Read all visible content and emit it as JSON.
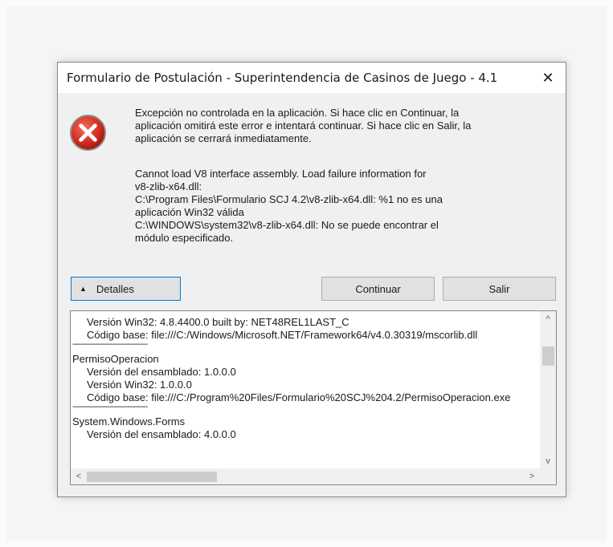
{
  "dialog": {
    "title": "Formulario de Postulación - Superintendencia de Casinos de Juego - 4.1",
    "close_symbol": "✕",
    "message_lines": [
      "Excepción no controlada en la aplicación. Si hace clic en Continuar, la",
      "aplicación omitirá este error e intentará continuar. Si hace clic en Salir, la",
      "aplicación se cerrará inmediatamente."
    ],
    "error_lines": [
      "Cannot load V8 interface assembly. Load failure information for",
      "v8-zlib-x64.dll:",
      "C:\\Program Files\\Formulario SCJ 4.2\\v8-zlib-x64.dll: %1 no es una",
      "aplicación Win32 válida",
      "C:\\WINDOWS\\system32\\v8-zlib-x64.dll: No se puede encontrar el",
      "módulo especificado."
    ],
    "buttons": {
      "details": "Detalles",
      "details_arrow": "▲",
      "continue": "Continuar",
      "exit": "Salir"
    },
    "details_lines": [
      "Versión Win32: 4.8.4400.0 built by: NET48REL1LAST_C",
      "Código base: file:///C:/Windows/Microsoft.NET/Framework64/v4.0.30319/mscorlib.dll",
      "----------------------------------------",
      "PermisoOperacion",
      "Versión del ensamblado: 1.0.0.0",
      "Versión Win32: 1.0.0.0",
      "Código base: file:///C:/Program%20Files/Formulario%20SCJ%204.2/PermisoOperacion.exe",
      "----------------------------------------",
      "System.Windows.Forms",
      "Versión del ensamblado: 4.0.0.0"
    ],
    "scroll_arrows": {
      "up": "^",
      "down": "v",
      "left": "<",
      "right": ">"
    }
  }
}
